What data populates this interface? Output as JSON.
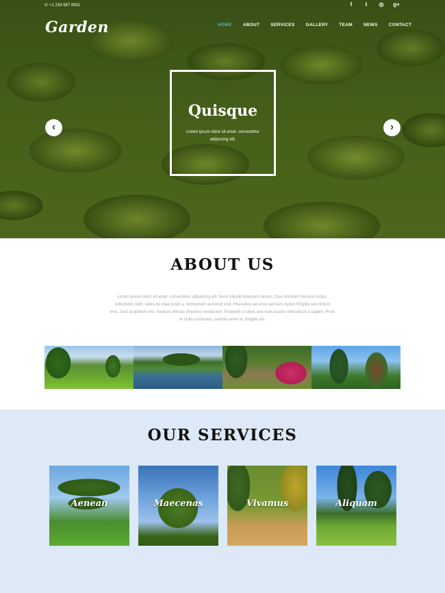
{
  "topbar": {
    "phone": "+1 234 567 8901",
    "socials": [
      {
        "icon": "facebook-icon",
        "glyph": "f"
      },
      {
        "icon": "twitter-icon",
        "glyph": "t"
      },
      {
        "icon": "dribbble-icon",
        "glyph": "◎"
      },
      {
        "icon": "google-plus-icon",
        "glyph": "g+"
      }
    ]
  },
  "header": {
    "logo": "Garden",
    "nav": [
      {
        "label": "HOME",
        "active": true
      },
      {
        "label": "ABOUT",
        "active": false
      },
      {
        "label": "SERVICES",
        "active": false
      },
      {
        "label": "GALLERY",
        "active": false
      },
      {
        "label": "TEAM",
        "active": false
      },
      {
        "label": "NEWS",
        "active": false
      },
      {
        "label": "CONTACT",
        "active": false
      }
    ],
    "active_color": "#4ab4e6"
  },
  "hero": {
    "title": "Quisque",
    "text": "Lorem ipsum dolor sit amet, consectetur adipiscing elit.",
    "prev_glyph": "‹",
    "next_glyph": "›"
  },
  "about": {
    "title": "ABOUT US",
    "text": "Lorem ipsum dolor sit amet, consectetur adipiscing elit. Nunc blandit interdum rutrum. Cras tincidunt rhoncus turpis, sollicitudin nibh, vehicula vitae turpis a, fermentum euismod erat. Phasellus vel eros sed sem luctus fringilla sed dictum eros. Sed at pretium nisi. Aenean ultrices pharetra vestibulum. Praesent a turpis sed nunc auctor vehicula et a sapien. Proin et nulla commodo, pretium enim et, fringilla elit."
  },
  "services": {
    "title": "OUR SERVICES",
    "items": [
      {
        "label": "Aenean"
      },
      {
        "label": "Maecenas"
      },
      {
        "label": "Vivamus"
      },
      {
        "label": "Aliquam"
      }
    ]
  }
}
